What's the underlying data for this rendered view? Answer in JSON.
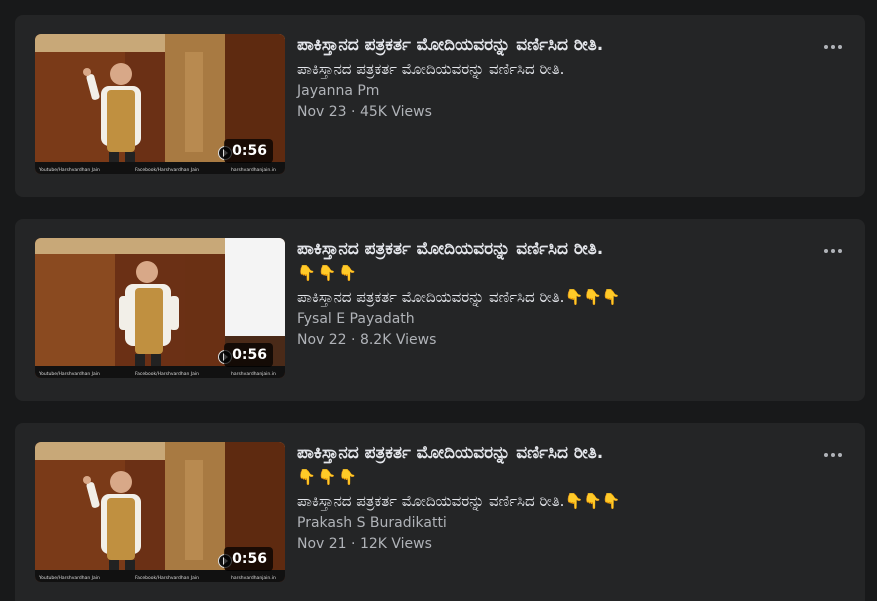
{
  "videos": [
    {
      "title": "ಪಾಕಿಸ್ತಾನದ ಪತ್ರಕರ್ತ ಮೋದಿಯವರನ್ನು ವರ್ಣಿಸಿದ ರೀತಿ.",
      "title_emoji": "",
      "description": "ಪಾಕಿಸ್ತಾನದ ಪತ್ರಕರ್ತ ಮೋದಿಯವರನ್ನು ವರ್ಣಿಸಿದ ರೀತಿ.",
      "author": "Jayanna Pm",
      "date": "Nov 23",
      "views": "45K Views",
      "duration": "0:56"
    },
    {
      "title": "ಪಾಕಿಸ್ತಾನದ ಪತ್ರಕರ್ತ ಮೋದಿಯವರನ್ನು ವರ್ಣಿಸಿದ ರೀತಿ.",
      "title_emoji": "👇👇👇",
      "description": "ಪಾಕಿಸ್ತಾನದ ಪತ್ರಕರ್ತ ಮೋದಿಯವರನ್ನು ವರ್ಣಿಸಿದ ರೀತಿ.👇👇👇",
      "author": "Fysal E Payadath",
      "date": "Nov 22",
      "views": "8.2K Views",
      "duration": "0:56"
    },
    {
      "title": "ಪಾಕಿಸ್ತಾನದ ಪತ್ರಕರ್ತ ಮೋದಿಯವರನ್ನು ವರ್ಣಿಸಿದ ರೀತಿ.",
      "title_emoji": "👇👇👇",
      "description": "ಪಾಕಿಸ್ತಾನದ ಪತ್ರಕರ್ತ ಮೋದಿಯವರನ್ನು ವರ್ಣಿಸಿದ ರೀತಿ.👇👇👇",
      "author": "Prakash S Buradikatti",
      "date": "Nov 21",
      "views": "12K Views",
      "duration": "0:56"
    }
  ],
  "thumbnail_watermark": {
    "left": "Youtube/Harshvardhan Jain",
    "middle": "Facebook/Harshvardhan Jain",
    "right": "harshvardhanjain.in"
  },
  "separator": " · ",
  "more_icon": "more-horizontal-icon",
  "colors": {
    "page_bg": "#18191a",
    "card_bg": "#242526",
    "primary_text": "#e4e6eb",
    "secondary_text": "#b0b3b8"
  }
}
